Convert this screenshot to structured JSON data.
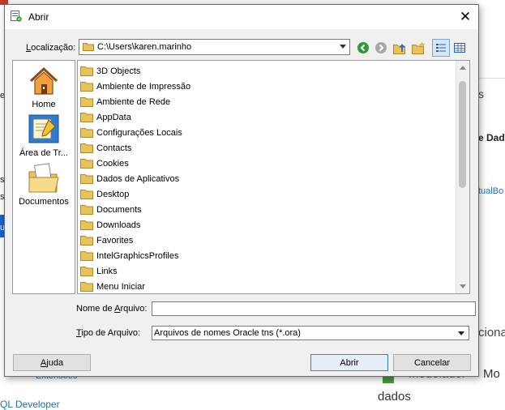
{
  "background": {
    "left_texts": [
      "e",
      "s",
      "s",
      "u"
    ],
    "right_texts": [
      "s",
      "e Dad",
      "tualBo",
      "ciona"
    ],
    "bottom_texts": [
      "Extensões",
      "QL Developer",
      "Modelador",
      "Mo",
      "dados"
    ]
  },
  "dialog": {
    "title": "Abrir",
    "close_glyph": "✕"
  },
  "location": {
    "label_pre": "",
    "label_u": "L",
    "label_post": "ocalização:",
    "path": "C:\\Users\\karen.marinho"
  },
  "sidebar": {
    "items": [
      {
        "label": "Home",
        "icon": "house-icon"
      },
      {
        "label": "Área de Tr...",
        "icon": "desktop-icon"
      },
      {
        "label": "Documentos",
        "icon": "documents-folder-icon"
      }
    ]
  },
  "files": [
    "3D Objects",
    "Ambiente de Impressão",
    "Ambiente de Rede",
    "AppData",
    "Configurações Locais",
    "Contacts",
    "Cookies",
    "Dados de Aplicativos",
    "Desktop",
    "Documents",
    "Downloads",
    "Favorites",
    "IntelGraphicsProfiles",
    "Links",
    "Menu Iniciar"
  ],
  "filename": {
    "label_pre": "Nome de ",
    "label_u": "A",
    "label_post": "rquivo:",
    "value": ""
  },
  "filetype": {
    "label_pre": "",
    "label_u": "T",
    "label_post": "ipo de Arquivo:",
    "value": "Arquivos de nomes Oracle tns (*.ora)"
  },
  "buttons": {
    "help_u": "A",
    "help_post": "juda",
    "open": "Abrir",
    "cancel": "Cancelar"
  },
  "colors": {
    "folder": "#e8c35a",
    "accent": "#3c7fd0"
  }
}
